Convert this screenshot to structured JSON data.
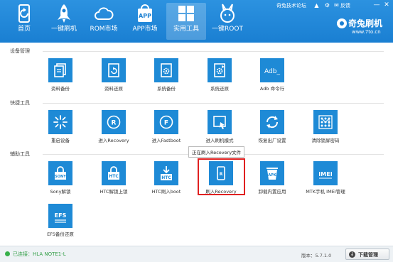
{
  "app": {
    "brand_name": "奇兔刷机",
    "brand_url": "www.7to.cn",
    "forum_link": "奇兔技术论坛",
    "feedback_label": "反馈",
    "accent_color": "#1e8ad6"
  },
  "nav": [
    {
      "label": "首页",
      "icon": "refresh-phone-icon"
    },
    {
      "label": "一键刷机",
      "icon": "rocket-icon"
    },
    {
      "label": "ROM市场",
      "icon": "cloud-icon"
    },
    {
      "label": "APP市场",
      "icon": "app-bag-icon"
    },
    {
      "label": "实用工具",
      "icon": "grid-icon",
      "active": true
    },
    {
      "label": "一键ROOT",
      "icon": "rabbit-icon"
    }
  ],
  "sections": [
    {
      "title": "设备管理"
    },
    {
      "title": "快捷工具"
    },
    {
      "title": "辅助工具"
    }
  ],
  "tools": {
    "device": [
      {
        "label": "资料备份"
      },
      {
        "label": "资料还原"
      },
      {
        "label": "系统备份"
      },
      {
        "label": "系统还原"
      },
      {
        "label": "Adb 命令行",
        "tile_text": "Adb_"
      }
    ],
    "quick": [
      {
        "label": "重启设备"
      },
      {
        "label": "进入Recovery"
      },
      {
        "label": "进入Fastboot"
      },
      {
        "label": "进入刷机模式"
      },
      {
        "label": "恢复出厂设置"
      },
      {
        "label": "清除锁屏密码"
      }
    ],
    "aux": [
      {
        "label": "Sony解锁",
        "tile_text": "SONY"
      },
      {
        "label": "HTC解锁上锁",
        "tile_text": "HTC"
      },
      {
        "label": "HTC刷入boot",
        "tile_text": "HTC"
      },
      {
        "label": "刷入Recovery"
      },
      {
        "label": "卸载内置应用",
        "tile_text": "APK"
      },
      {
        "label": "MTK手机 IMEI管理",
        "tile_text": "IMEI"
      },
      {
        "label": "EFS备份还原",
        "tile_text": "EFS"
      }
    ]
  },
  "tooltip": "正在刷入Recovery文件",
  "status": {
    "connection": "已连接：HLA NOTE1-L",
    "version": "版本：5.7.1.0",
    "download_manager": "下载管理"
  }
}
